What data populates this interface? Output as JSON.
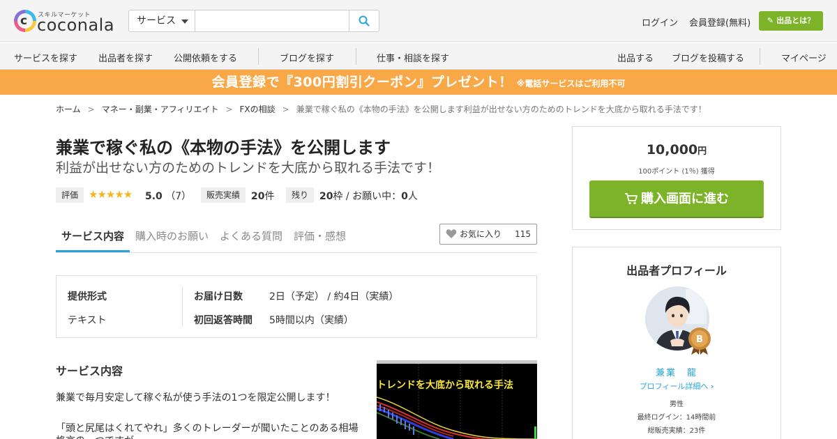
{
  "header": {
    "logo_sub": "スキルマーケット",
    "logo_text": "coconala",
    "search": {
      "category": "サービス",
      "placeholder": ""
    },
    "login": "ログイン",
    "register": "会員登録(無料)",
    "seller_button": "出品とは？"
  },
  "nav": {
    "left": [
      "サービスを探す",
      "出品者を探す",
      "公開依頼をする",
      "ブログを探す",
      "仕事・相談を探す"
    ],
    "right": [
      "出品する",
      "ブログを投稿する",
      "マイページ"
    ]
  },
  "banner": {
    "main": "会員登録で『300円割引クーポン』プレゼント！",
    "note": "※電話サービスはご利用不可"
  },
  "breadcrumb": [
    "ホーム",
    "マネー・副業・アフィリエイト",
    "FXの相談",
    "兼業で稼ぐ私の《本物の手法》を公開します利益が出せない方のためのトレンドを大底から取れる手法です！"
  ],
  "breadcrumb_sep": ">",
  "service": {
    "title": "兼業で稼ぐ私の《本物の手法》を公開します",
    "subtitle": "利益が出せない方のためのトレンドを大底から取れる手法です！"
  },
  "stats": {
    "rating_label": "評価",
    "stars": "★★★★★",
    "rating": "5.0",
    "rating_count": "（7）",
    "sales_label": "販売実績",
    "sales_count": "20",
    "sales_unit": "件",
    "remaining_label": "残り",
    "remaining_count": "20",
    "remaining_text": "枠 / お願い中：",
    "requesting_count": "0",
    "requesting_unit": "人"
  },
  "tabs": [
    "サービス内容",
    "購入時のお願い",
    "よくある質問",
    "評価・感想"
  ],
  "favorite": {
    "label": "お気に入り",
    "count": "115"
  },
  "info": {
    "format_label": "提供形式",
    "format_value": "テキスト",
    "delivery_label": "お届け日数",
    "delivery_value": "2日（予定） / 約4日（実績）",
    "reply_label": "初回返答時間",
    "reply_value": "5時間以内（実績）"
  },
  "description": {
    "heading": "サービス内容",
    "line1": "兼業で毎月安定して稼ぐ私が使う手法の1つを限定公開します！",
    "line2": "「頭と尻尾はくれてやれ」多くのトレーダーが聞いたことのある相場",
    "line3": "格言の一つですが、"
  },
  "chart_overlay": "トレンドを大底から取れる手法",
  "price": {
    "amount": "10,000",
    "unit": "円",
    "points": "100ポイント (1％) 獲得",
    "buy_button": "購入画面に進む"
  },
  "profile": {
    "title": "出品者プロフィール",
    "badge": "B",
    "name": "兼業　龍",
    "detail_link": "プロフィール詳細へ",
    "gender": "男性",
    "last_login": "最終ログイン：14時間前",
    "total_sales": "総販売実績：23件"
  },
  "colors": {
    "accent_green": "#7cb328",
    "banner_orange": "#f8a847",
    "link_blue": "#2aa4d8",
    "star_yellow": "#f3b61f"
  }
}
